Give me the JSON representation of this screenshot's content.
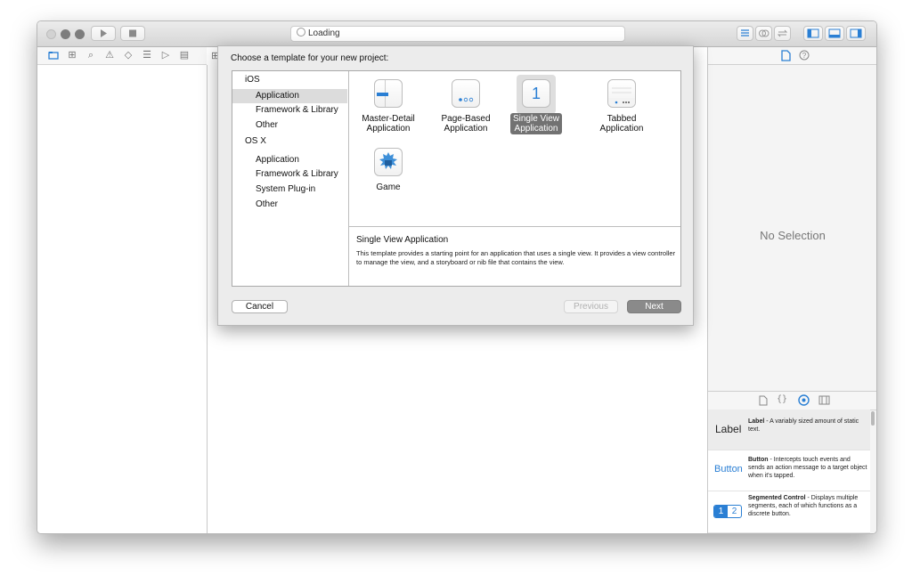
{
  "toolbar": {
    "activity_text": "Loading"
  },
  "sheet": {
    "title": "Choose a template for your new project:",
    "categories": {
      "ios_header": "iOS",
      "ios_items": [
        "Application",
        "Framework & Library",
        "Other"
      ],
      "osx_header": "OS X",
      "osx_items": [
        "Application",
        "Framework & Library",
        "System Plug-in",
        "Other"
      ],
      "selected": "iOS / Application"
    },
    "templates": [
      {
        "line1": "Master-Detail",
        "line2": "Application",
        "icon": "master-detail-icon"
      },
      {
        "line1": "Page-Based",
        "line2": "Application",
        "icon": "page-based-icon"
      },
      {
        "line1": "Single View",
        "line2": "Application",
        "icon": "single-view-icon",
        "glyph": "1",
        "selected": true
      },
      {
        "line1": "Tabbed",
        "line2": "Application",
        "icon": "tabbed-icon"
      },
      {
        "line1": "Game",
        "line2": "",
        "icon": "game-icon"
      }
    ],
    "description": {
      "title": "Single View Application",
      "body": "This template provides a starting point for an application that uses a single view. It provides a view controller to manage the view, and a storyboard or nib file that contains the view."
    },
    "buttons": {
      "cancel": "Cancel",
      "previous": "Previous",
      "next": "Next"
    }
  },
  "inspector": {
    "no_selection": "No Selection"
  },
  "library": {
    "items": [
      {
        "preview": "Label",
        "name": "Label",
        "desc": " - A variably sized amount of static text."
      },
      {
        "preview": "Button",
        "name": "Button",
        "desc": " - Intercepts touch events and sends an action message to a target object when it's tapped."
      },
      {
        "preview_a": "1",
        "preview_b": "2",
        "name": "Segmented Control",
        "desc": " - Displays multiple segments, each of which functions as a discrete button."
      }
    ]
  },
  "colors": {
    "accent": "#2a7fd4",
    "selection_gray": "#727272"
  }
}
